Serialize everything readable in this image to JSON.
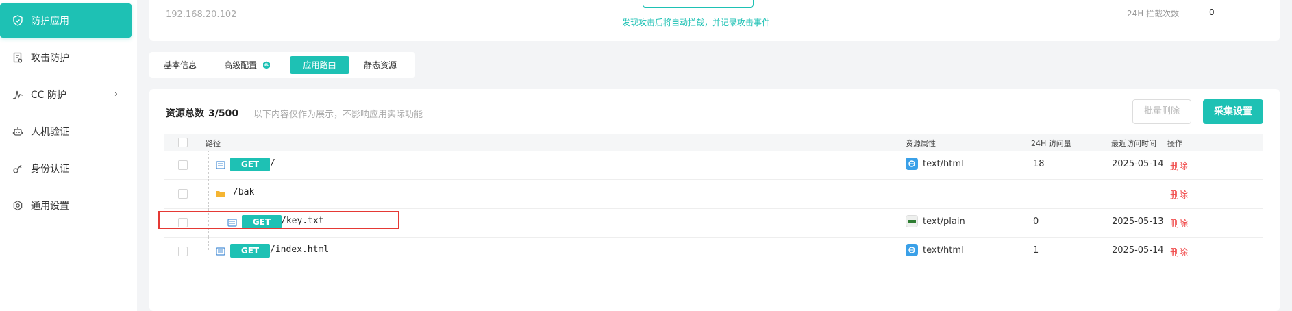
{
  "sidebar": {
    "items": [
      {
        "label": "防护应用",
        "icon": "shield-icon",
        "active": true
      },
      {
        "label": "攻击防护",
        "icon": "document-shield-icon"
      },
      {
        "label": "CC 防护",
        "icon": "pulse-icon",
        "has_submenu": true
      },
      {
        "label": "人机验证",
        "icon": "robot-icon"
      },
      {
        "label": "身份认证",
        "icon": "key-icon"
      },
      {
        "label": "通用设置",
        "icon": "gear-icon"
      }
    ]
  },
  "top_card": {
    "ip": "192.168.20.102",
    "note": "发现攻击后将自动拦截，并记录攻击事件",
    "stat_label": "24H 拦截次数",
    "stat_value": "0"
  },
  "tabs": [
    {
      "label": "基本信息"
    },
    {
      "label": "高级配置",
      "badge": "pro-badge-icon"
    },
    {
      "label": "应用路由",
      "active": true
    },
    {
      "label": "静态资源"
    }
  ],
  "resources": {
    "title": "资源总数",
    "count": "3/500",
    "hint": "以下内容仅作为展示，不影响应用实际功能",
    "batch_delete_label": "批量删除",
    "collect_label": "采集设置"
  },
  "table": {
    "headers": {
      "path": "路径",
      "attr": "资源属性",
      "visits": "24H 访问量",
      "last_visit": "最近访问时间",
      "action": "操作"
    },
    "rows": [
      {
        "kind": "file",
        "method": "GET",
        "path": "/",
        "type": "text/html",
        "type_icon": "html-file-icon",
        "visits": "18",
        "date": "2025-05-14",
        "action": "删除"
      },
      {
        "kind": "folder",
        "method": "",
        "path": "/bak",
        "type": "",
        "visits": "",
        "date": "",
        "action": "删除"
      },
      {
        "kind": "file",
        "method": "GET",
        "path": "/key.txt",
        "type": "text/plain",
        "type_icon": "text-file-icon",
        "visits": "0",
        "date": "2025-05-13",
        "action": "删除"
      },
      {
        "kind": "file",
        "method": "GET",
        "path": "/index.html",
        "type": "text/html",
        "type_icon": "html-file-icon",
        "visits": "1",
        "date": "2025-05-14",
        "action": "删除"
      }
    ]
  },
  "colors": {
    "accent": "#1ec1b4",
    "danger": "#f04848",
    "highlight": "#e53935"
  }
}
